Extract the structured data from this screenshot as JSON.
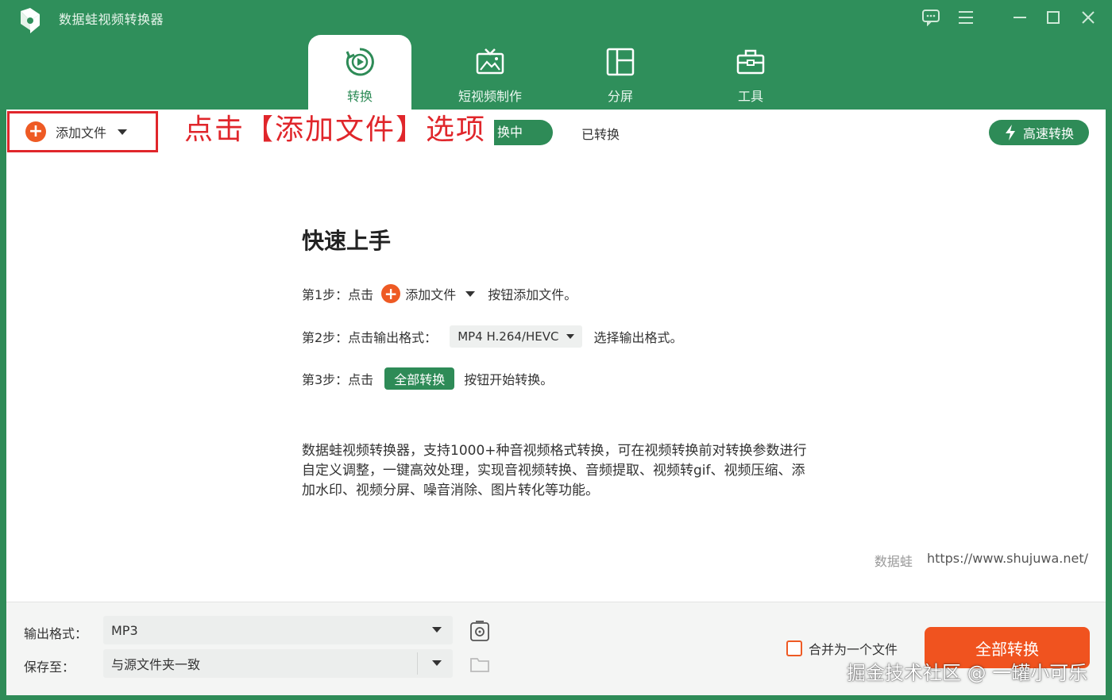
{
  "app": {
    "title": "数据蛙视频转换器"
  },
  "nav": {
    "tabs": [
      {
        "label": "转换",
        "icon": "convert-icon",
        "active": true
      },
      {
        "label": "短视频制作",
        "icon": "tv-icon",
        "active": false
      },
      {
        "label": "分屏",
        "icon": "split-screen-icon",
        "active": false
      },
      {
        "label": "工具",
        "icon": "toolbox-icon",
        "active": false
      }
    ]
  },
  "toolbar": {
    "add_file": "添加文件",
    "annotation": "点击【添加文件】选项",
    "tab_converting": "转换中",
    "tab_converting_visible": "换中",
    "tab_done": "已转换",
    "fast_convert": "高速转换"
  },
  "guide": {
    "title": "快速上手",
    "step1_prefix": "第1步：点击",
    "step1_button": "添加文件",
    "step1_suffix": "按钮添加文件。",
    "step2_prefix": "第2步：点击输出格式：",
    "step2_format": "MP4 H.264/HEVC",
    "step2_suffix": "选择输出格式。",
    "step3_prefix": "第3步：点击",
    "step3_button": "全部转换",
    "step3_suffix": "按钮开始转换。",
    "description": "数据蛙视频转换器，支持1000+种音视频格式转换，可在视频转换前对转换参数进行自定义调整，一键高效处理，实现音视频转换、音频提取、视频转gif、视频压缩、添加水印、视频分屏、噪音消除、图片转化等功能。"
  },
  "brand": {
    "name": "数据蛙",
    "url": "https://www.shujuwa.net/"
  },
  "footer": {
    "output_format_label": "输出格式：",
    "output_format_value": "MP3",
    "save_to_label": "保存至：",
    "save_to_value": "与源文件夹一致",
    "merge_label": "合并为一个文件",
    "merge_checked": false,
    "convert_all": "全部转换"
  },
  "watermark": "掘金技术社区 @ 一罐小可乐",
  "colors": {
    "brand_green": "#2e8b57",
    "accent_orange": "#f0531f",
    "annotation_red": "#e0262b"
  }
}
